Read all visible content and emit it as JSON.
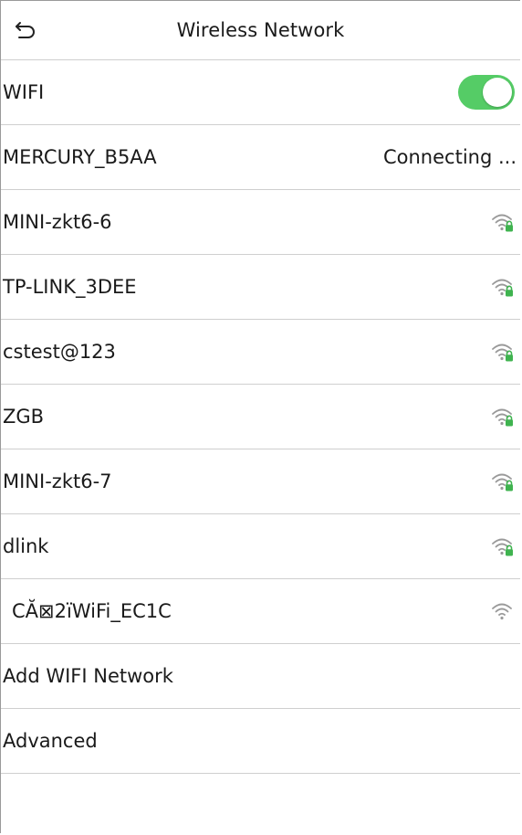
{
  "header": {
    "title": "Wireless Network",
    "back_icon": "back-arrow-icon"
  },
  "wifi_toggle": {
    "label": "WIFI",
    "on": true,
    "color": "#55cc66"
  },
  "networks": [
    {
      "ssid": "MERCURY_B5AA",
      "status": "Connecting ...",
      "locked": false,
      "show_signal": false
    },
    {
      "ssid": "MINI-zkt6-6",
      "status": "",
      "locked": true,
      "show_signal": true
    },
    {
      "ssid": "TP-LINK_3DEE",
      "status": "",
      "locked": true,
      "show_signal": true
    },
    {
      "ssid": "cstest@123",
      "status": "",
      "locked": true,
      "show_signal": true
    },
    {
      "ssid": "ZGB",
      "status": "",
      "locked": true,
      "show_signal": true
    },
    {
      "ssid": "MINI-zkt6-7",
      "status": "",
      "locked": true,
      "show_signal": true
    },
    {
      "ssid": "dlink",
      "status": "",
      "locked": true,
      "show_signal": true
    },
    {
      "ssid": "CĂ⊠2ïWiFi_EC1C",
      "status": "",
      "locked": false,
      "show_signal": true
    }
  ],
  "actions": {
    "add_network": "Add WIFI Network",
    "advanced": "Advanced"
  },
  "colors": {
    "lock_green": "#3fb34f",
    "signal_gray": "#9a9a9a",
    "divider": "#cfcfcf"
  }
}
